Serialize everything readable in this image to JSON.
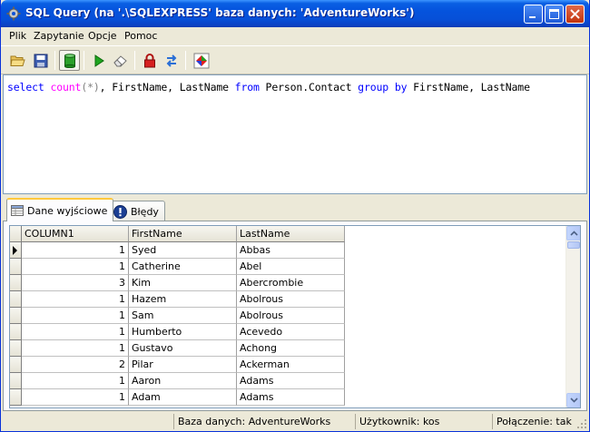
{
  "window": {
    "title": "SQL Query (na '.\\SQLEXPRESS' baza danych: 'AdventureWorks')"
  },
  "menu": [
    "Plik",
    "Zapytanie",
    "Opcje",
    "Pomoc"
  ],
  "toolbar": {
    "icons": [
      "open-folder-icon",
      "save-disk-icon",
      "database-icon",
      "run-icon",
      "eraser-icon",
      "lock-icon",
      "swap-arrows-icon",
      "diamond-icon"
    ]
  },
  "editor": {
    "parts": [
      {
        "t": "select",
        "c": "kw"
      },
      {
        "t": " ",
        "c": ""
      },
      {
        "t": "count",
        "c": "fn"
      },
      {
        "t": "(*)",
        "c": "op"
      },
      {
        "t": ", FirstName, LastName ",
        "c": ""
      },
      {
        "t": "from",
        "c": "kw"
      },
      {
        "t": " Person.Contact ",
        "c": ""
      },
      {
        "t": "group by",
        "c": "kw"
      },
      {
        "t": " FirstName, LastName",
        "c": ""
      }
    ]
  },
  "tabs": {
    "output": "Dane wyjściowe",
    "errors": "Błędy"
  },
  "grid": {
    "columns": [
      "COLUMN1",
      "FirstName",
      "LastName"
    ],
    "rows": [
      [
        "1",
        "Syed",
        "Abbas"
      ],
      [
        "1",
        "Catherine",
        "Abel"
      ],
      [
        "3",
        "Kim",
        "Abercrombie"
      ],
      [
        "1",
        "Hazem",
        "Abolrous"
      ],
      [
        "1",
        "Sam",
        "Abolrous"
      ],
      [
        "1",
        "Humberto",
        "Acevedo"
      ],
      [
        "1",
        "Gustavo",
        "Achong"
      ],
      [
        "2",
        "Pilar",
        "Ackerman"
      ],
      [
        "1",
        "Aaron",
        "Adams"
      ],
      [
        "1",
        "Adam",
        "Adams"
      ]
    ]
  },
  "status": {
    "database": "Baza danych: AdventureWorks",
    "user": "Użytkownik: kos",
    "connection": "Połączenie: tak"
  },
  "colors": {
    "keyword": "#0000FF",
    "function": "#FF00FF",
    "operator": "#808080",
    "titlebar": "#0553DD"
  }
}
